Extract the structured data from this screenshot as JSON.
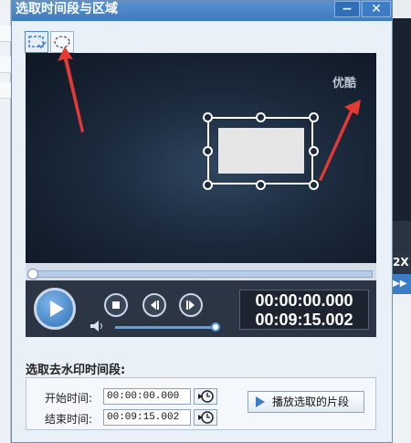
{
  "window": {
    "title": "选取时间段与区域",
    "minimize_label": "−",
    "close_label": "✕"
  },
  "shape_tools": [
    {
      "name": "rectangle-select",
      "active": true
    },
    {
      "name": "ellipse-select",
      "active": false
    }
  ],
  "video": {
    "watermark_text": "优酷"
  },
  "player": {
    "current_time": "00:00:00.000",
    "total_time": "00:09:15.002",
    "progress": 0.0,
    "volume": 1.0
  },
  "section": {
    "label": "选取去水印时间段:"
  },
  "range": {
    "start_label": "开始时间:",
    "start_value": "00:00:00.000",
    "end_label": "结束时间:",
    "end_value": "00:09:15.002",
    "play_selection_label": "播放选取的片段"
  },
  "background": {
    "right_label_1": "2X",
    "right_label_2": "▶▶"
  },
  "colors": {
    "titlebar": "#3d7bc0",
    "accent": "#3b7dc4",
    "arrow": "#e53935",
    "video_bg": "#1b2a3c"
  }
}
